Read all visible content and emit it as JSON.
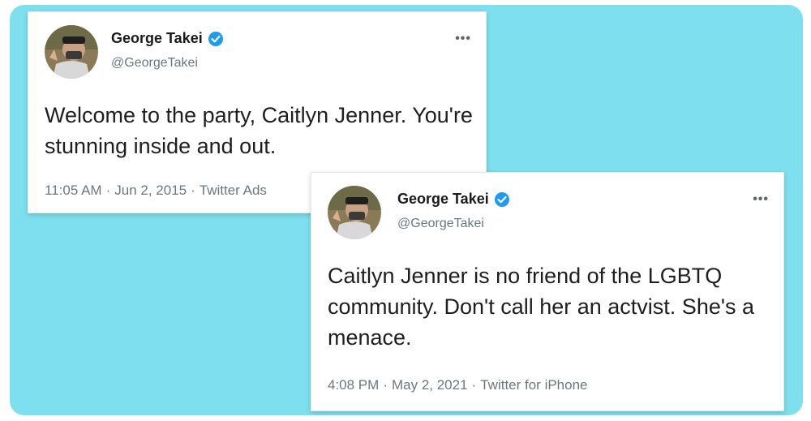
{
  "colors": {
    "background_panel": "#7ee0ee",
    "card": "#ffffff",
    "verified": "#1d9bf0",
    "secondary_text": "#6b7780"
  },
  "tweets": [
    {
      "display_name": "George Takei",
      "handle": "@GeorgeTakei",
      "verified": true,
      "text": "Welcome to the party, Caitlyn Jenner. You're stunning inside and out.",
      "time": "11:05 AM",
      "date": "Jun 2, 2015",
      "source": "Twitter Ads",
      "more_icon": "more-horizontal-icon"
    },
    {
      "display_name": "George Takei",
      "handle": "@GeorgeTakei",
      "verified": true,
      "text": "Caitlyn Jenner is no friend of the LGBTQ community. Don't call her an actvist. She's a menace.",
      "time": "4:08 PM",
      "date": "May 2, 2021",
      "source": "Twitter for iPhone",
      "more_icon": "more-horizontal-icon"
    }
  ]
}
